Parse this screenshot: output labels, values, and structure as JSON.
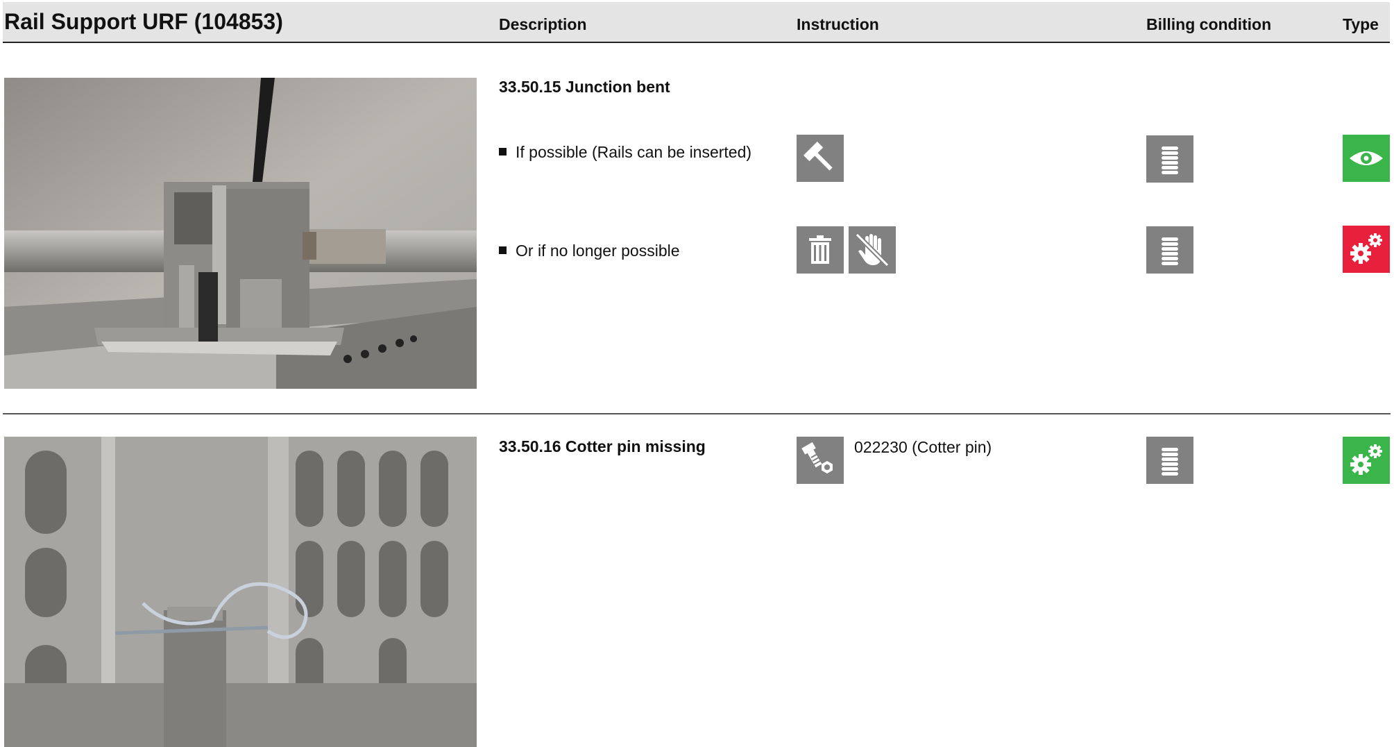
{
  "header": {
    "title": "Rail Support URF (104853)",
    "col_description": "Description",
    "col_instruction": "Instruction",
    "col_billing": "Billing condition",
    "col_type": "Type"
  },
  "rows": [
    {
      "title": "33.50.15 Junction bent",
      "items": [
        {
          "text": "If possible (Rails can be inserted)",
          "instruction_icons": [
            "hammer-icon"
          ],
          "billing_icon": "coin-stack-icon",
          "type_icon": "eye-icon",
          "type_color": "#3ab54a"
        },
        {
          "text": "Or if no longer possible",
          "instruction_icons": [
            "trash-icon",
            "no-touch-icon"
          ],
          "billing_icon": "coin-stack-icon",
          "type_icon": "gears-icon",
          "type_color": "#e8203c"
        }
      ]
    },
    {
      "title": "33.50.16 Cotter pin missing",
      "instruction_icons": [
        "bolt-nut-icon"
      ],
      "instruction_text": "022230 (Cotter pin)",
      "billing_icon": "coin-stack-icon",
      "type_icon": "gears-icon",
      "type_color": "#3ab54a"
    }
  ],
  "colors": {
    "header_bg": "#e4e4e4",
    "icon_gray": "#818181",
    "type_green": "#3ab54a",
    "type_red": "#e8203c"
  }
}
